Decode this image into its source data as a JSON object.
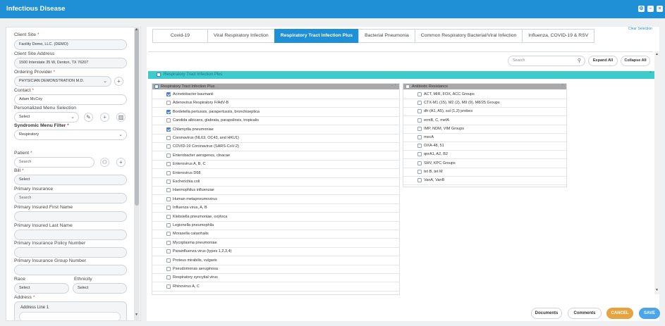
{
  "window": {
    "title": "Infectious Disease"
  },
  "left": {
    "client_site": {
      "label": "Client Site",
      "value": "Facility Demo, LLC. (DEMO)"
    },
    "client_site_address": {
      "label": "Client Site Address",
      "value": "1500 Interstate 35 W, Denton, TX 76207"
    },
    "ordering_provider": {
      "label": "Ordering Provider",
      "value": "PHYSICIAN DEMONSTRATION M.D."
    },
    "contact": {
      "label": "Contact",
      "value": "Adam McCoy"
    },
    "personalized_menu": {
      "label": "Personalized Menu Selection",
      "value": "Select"
    },
    "syndromic_menu": {
      "label": "Syndromic Menu Filter",
      "value": "Respiratory"
    },
    "patient": {
      "label": "Patient",
      "placeholder": "Search"
    },
    "bill": {
      "label": "Bill",
      "value": "Select"
    },
    "primary_insurance": {
      "label": "Primary Insurance",
      "placeholder": "Search"
    },
    "primary_insured_first": {
      "label": "Primary Insured First Name"
    },
    "primary_insured_last": {
      "label": "Primary Insured Last Name"
    },
    "policy_number": {
      "label": "Primary Insurance Policy Number"
    },
    "group_number": {
      "label": "Primary Insurance Group Number"
    },
    "race": {
      "label": "Race",
      "value": "Select"
    },
    "ethnicity": {
      "label": "Ethnicity",
      "value": "Select"
    },
    "address": {
      "label": "Address",
      "line1": "Address Line 1"
    }
  },
  "tabs": [
    {
      "label": "Covid-19"
    },
    {
      "label": "Viral Respiratory Infection"
    },
    {
      "label": "Respiratory Tract Infection Plus"
    },
    {
      "label": "Bacterial Pneumonia"
    },
    {
      "label": "Common Respiratory Bacterial/Viral Infection"
    },
    {
      "label": "Influenza, COVID-19 & RSV"
    }
  ],
  "clear_selection": "Clear Selection",
  "search_placeholder": "Search",
  "expand_all": "Expand All",
  "collapse_all": "Collapse All",
  "group_bar": "Respiratory Tract Infection Plus",
  "left_panel": {
    "header": "Respiratory Tract Infection Plus",
    "items": [
      {
        "label": "Acinetobacter baumanii",
        "checked": true
      },
      {
        "label": "Adenovirus Respiratory F/AdV-B",
        "checked": false
      },
      {
        "label": "Bordetella pertussis, parapertussis, bronchiseptica",
        "checked": true
      },
      {
        "label": "Candida albicans, glabrata, parapsilosis, tropicalis",
        "checked": false
      },
      {
        "label": "Chlamydia pneumoniae",
        "checked": true
      },
      {
        "label": "Coronavirus (NL63, OC43, and HKU1)",
        "checked": false
      },
      {
        "label": "COVID-19 Coronavirus (SARS-CoV-2)",
        "checked": false
      },
      {
        "label": "Enterobacter aerogenes, cloacae",
        "checked": false
      },
      {
        "label": "Enterovirus A, B, C",
        "checked": false
      },
      {
        "label": "Enterovirus D68",
        "checked": false
      },
      {
        "label": "Escherichia coli",
        "checked": false
      },
      {
        "label": "Haemophilus influenzae",
        "checked": false
      },
      {
        "label": "Human metapneumovirus",
        "checked": false
      },
      {
        "label": "Influenza virus, A, B",
        "checked": false
      },
      {
        "label": "Klebsiella pneumoniae, oxytoca",
        "checked": false
      },
      {
        "label": "Legionella pneumophila",
        "checked": false
      },
      {
        "label": "Moraxella catarrhalis",
        "checked": false
      },
      {
        "label": "Mycoplasma pneumoniae",
        "checked": false
      },
      {
        "label": "Parainfluenza virus (types 1,2,3,4)",
        "checked": false
      },
      {
        "label": "Proteus mirabilis, vulgaris",
        "checked": false
      },
      {
        "label": "Pseudomonas aeruginosa",
        "checked": false
      },
      {
        "label": "Respiratory syncytial virus",
        "checked": false
      },
      {
        "label": "Rhinovirus A, C",
        "checked": false
      }
    ]
  },
  "right_panel": {
    "header": "Antibiotic Resistance",
    "items": [
      {
        "label": "ACT, MIR, FOX, ACC Groups"
      },
      {
        "label": "CTX-M1 (15), M2 (2), M9 (9), M8/25 Groups"
      },
      {
        "label": "dfr (A1, A5), sul (1,2) probes"
      },
      {
        "label": "ermB, C, mefA"
      },
      {
        "label": "IMP, NDM, VIM Groups"
      },
      {
        "label": "mecA"
      },
      {
        "label": "OXA-48, 51"
      },
      {
        "label": "qnrA1, A2, B2"
      },
      {
        "label": "SHV, KPC Groups"
      },
      {
        "label": "tet B, tet M"
      },
      {
        "label": "VanA, VanB"
      }
    ]
  },
  "footer": {
    "documents": "Documents",
    "comments": "Comments",
    "cancel": "CANCEL",
    "save": "SAVE"
  },
  "colors": {
    "primary": "#1f8fd6",
    "group_bar": "#3dcccb",
    "cancel": "#e7a33f",
    "save": "#4aa5ea"
  }
}
